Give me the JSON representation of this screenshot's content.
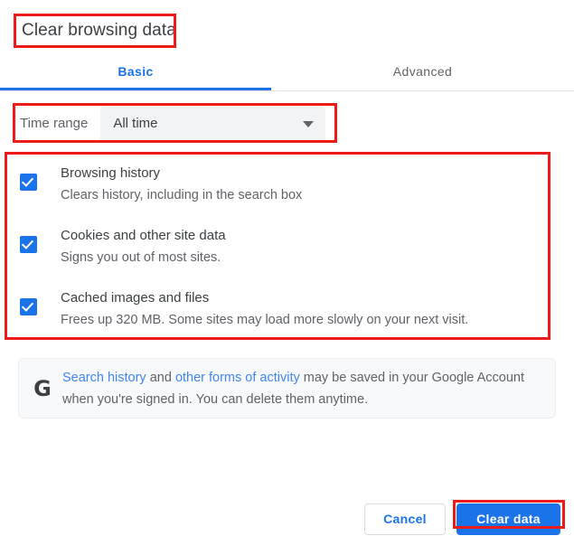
{
  "dialog": {
    "title": "Clear browsing data"
  },
  "tabs": [
    {
      "label": "Basic",
      "active": true
    },
    {
      "label": "Advanced",
      "active": false
    }
  ],
  "time_range": {
    "label": "Time range",
    "value": "All time",
    "icon": "chevron-down-icon"
  },
  "options": [
    {
      "title": "Browsing history",
      "description": "Clears history, including in the search box",
      "checked": true
    },
    {
      "title": "Cookies and other site data",
      "description": "Signs you out of most sites.",
      "checked": true
    },
    {
      "title": "Cached images and files",
      "description": "Frees up 320 MB. Some sites may load more slowly on your next visit.",
      "checked": true
    }
  ],
  "info_notice": {
    "icon": "google-g-logo",
    "link1": "Search history",
    "mid1": " and ",
    "link2": "other forms of activity",
    "tail": " may be saved in your Google Account when you're signed in. You can delete them anytime."
  },
  "footer": {
    "cancel_label": "Cancel",
    "clear_label": "Clear data"
  },
  "colors": {
    "accent_blue": "#1a73e8",
    "link_blue": "#4285f4",
    "annotation_red": "#ee1b1b",
    "text_primary": "#3c4043",
    "text_secondary": "#5f6368",
    "field_bg": "#f1f3f4",
    "info_bg": "#f8f9fa"
  }
}
